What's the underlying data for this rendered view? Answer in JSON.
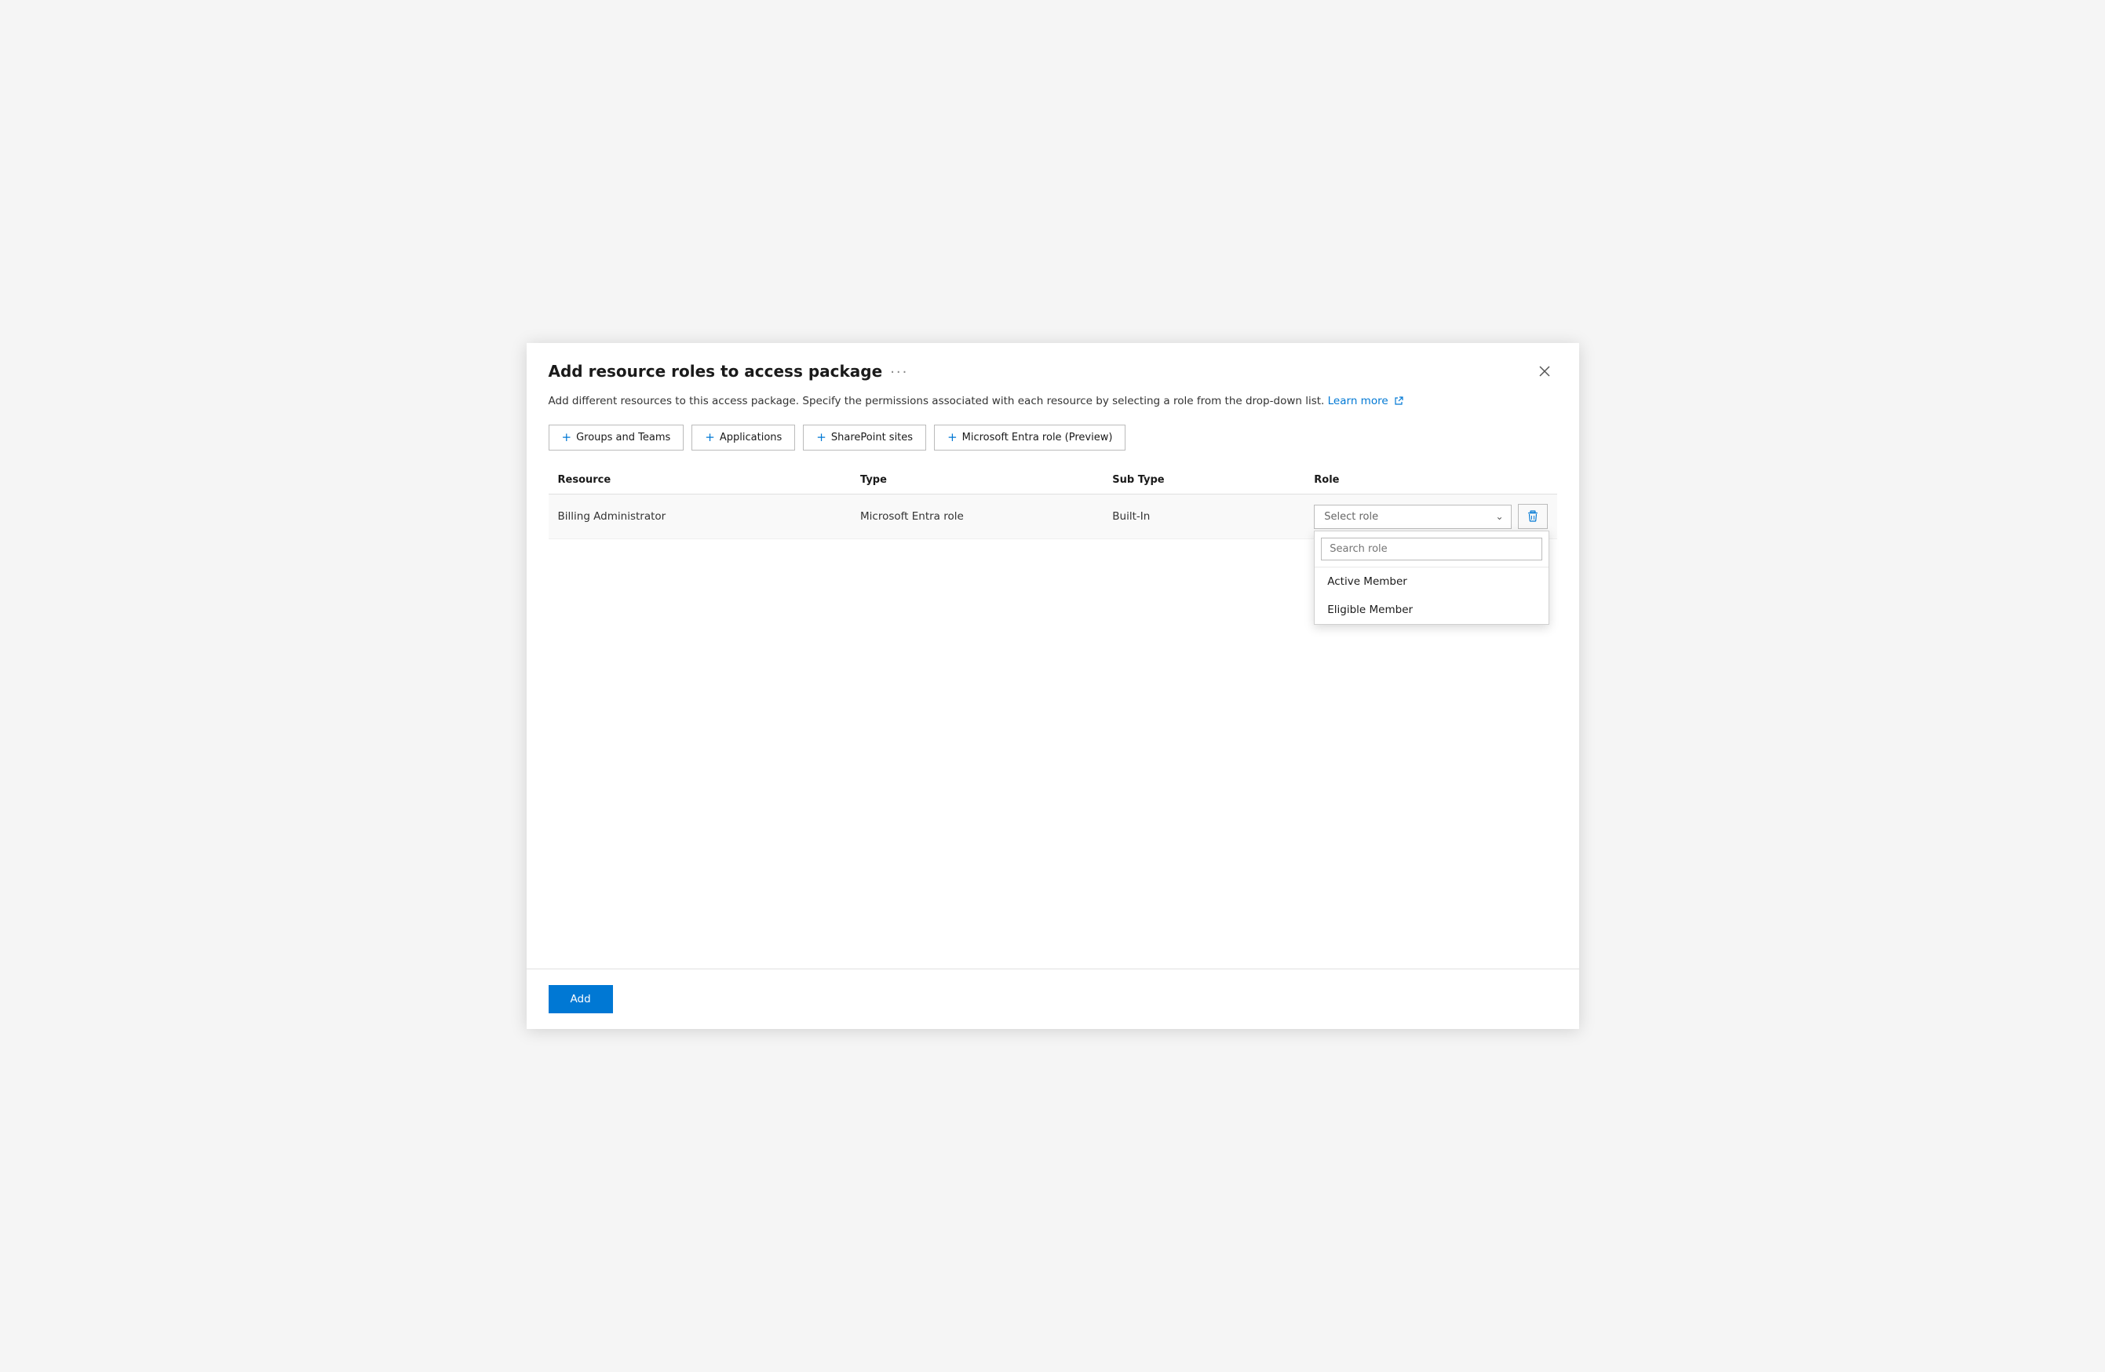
{
  "dialog": {
    "title": "Add resource roles to access package",
    "ellipsis": "···",
    "description": "Add different resources to this access package. Specify the permissions associated with each resource by selecting a role from the drop-down list.",
    "learn_more_label": "Learn more",
    "close_label": "×"
  },
  "toolbar": {
    "buttons": [
      {
        "id": "groups-teams",
        "label": "Groups and Teams"
      },
      {
        "id": "applications",
        "label": "Applications"
      },
      {
        "id": "sharepoint-sites",
        "label": "SharePoint sites"
      },
      {
        "id": "microsoft-entra-role",
        "label": "Microsoft Entra role (Preview)"
      }
    ]
  },
  "table": {
    "columns": [
      {
        "id": "resource",
        "label": "Resource"
      },
      {
        "id": "type",
        "label": "Type"
      },
      {
        "id": "subtype",
        "label": "Sub Type"
      },
      {
        "id": "role",
        "label": "Role"
      }
    ],
    "rows": [
      {
        "resource": "Billing Administrator",
        "type": "Microsoft Entra role",
        "subtype": "Built-In",
        "role_placeholder": "Select role"
      }
    ]
  },
  "dropdown": {
    "search_placeholder": "Search role",
    "items": [
      {
        "id": "active-member",
        "label": "Active Member"
      },
      {
        "id": "eligible-member",
        "label": "Eligible Member"
      }
    ]
  },
  "footer": {
    "add_label": "Add"
  },
  "colors": {
    "accent": "#0078d4"
  }
}
